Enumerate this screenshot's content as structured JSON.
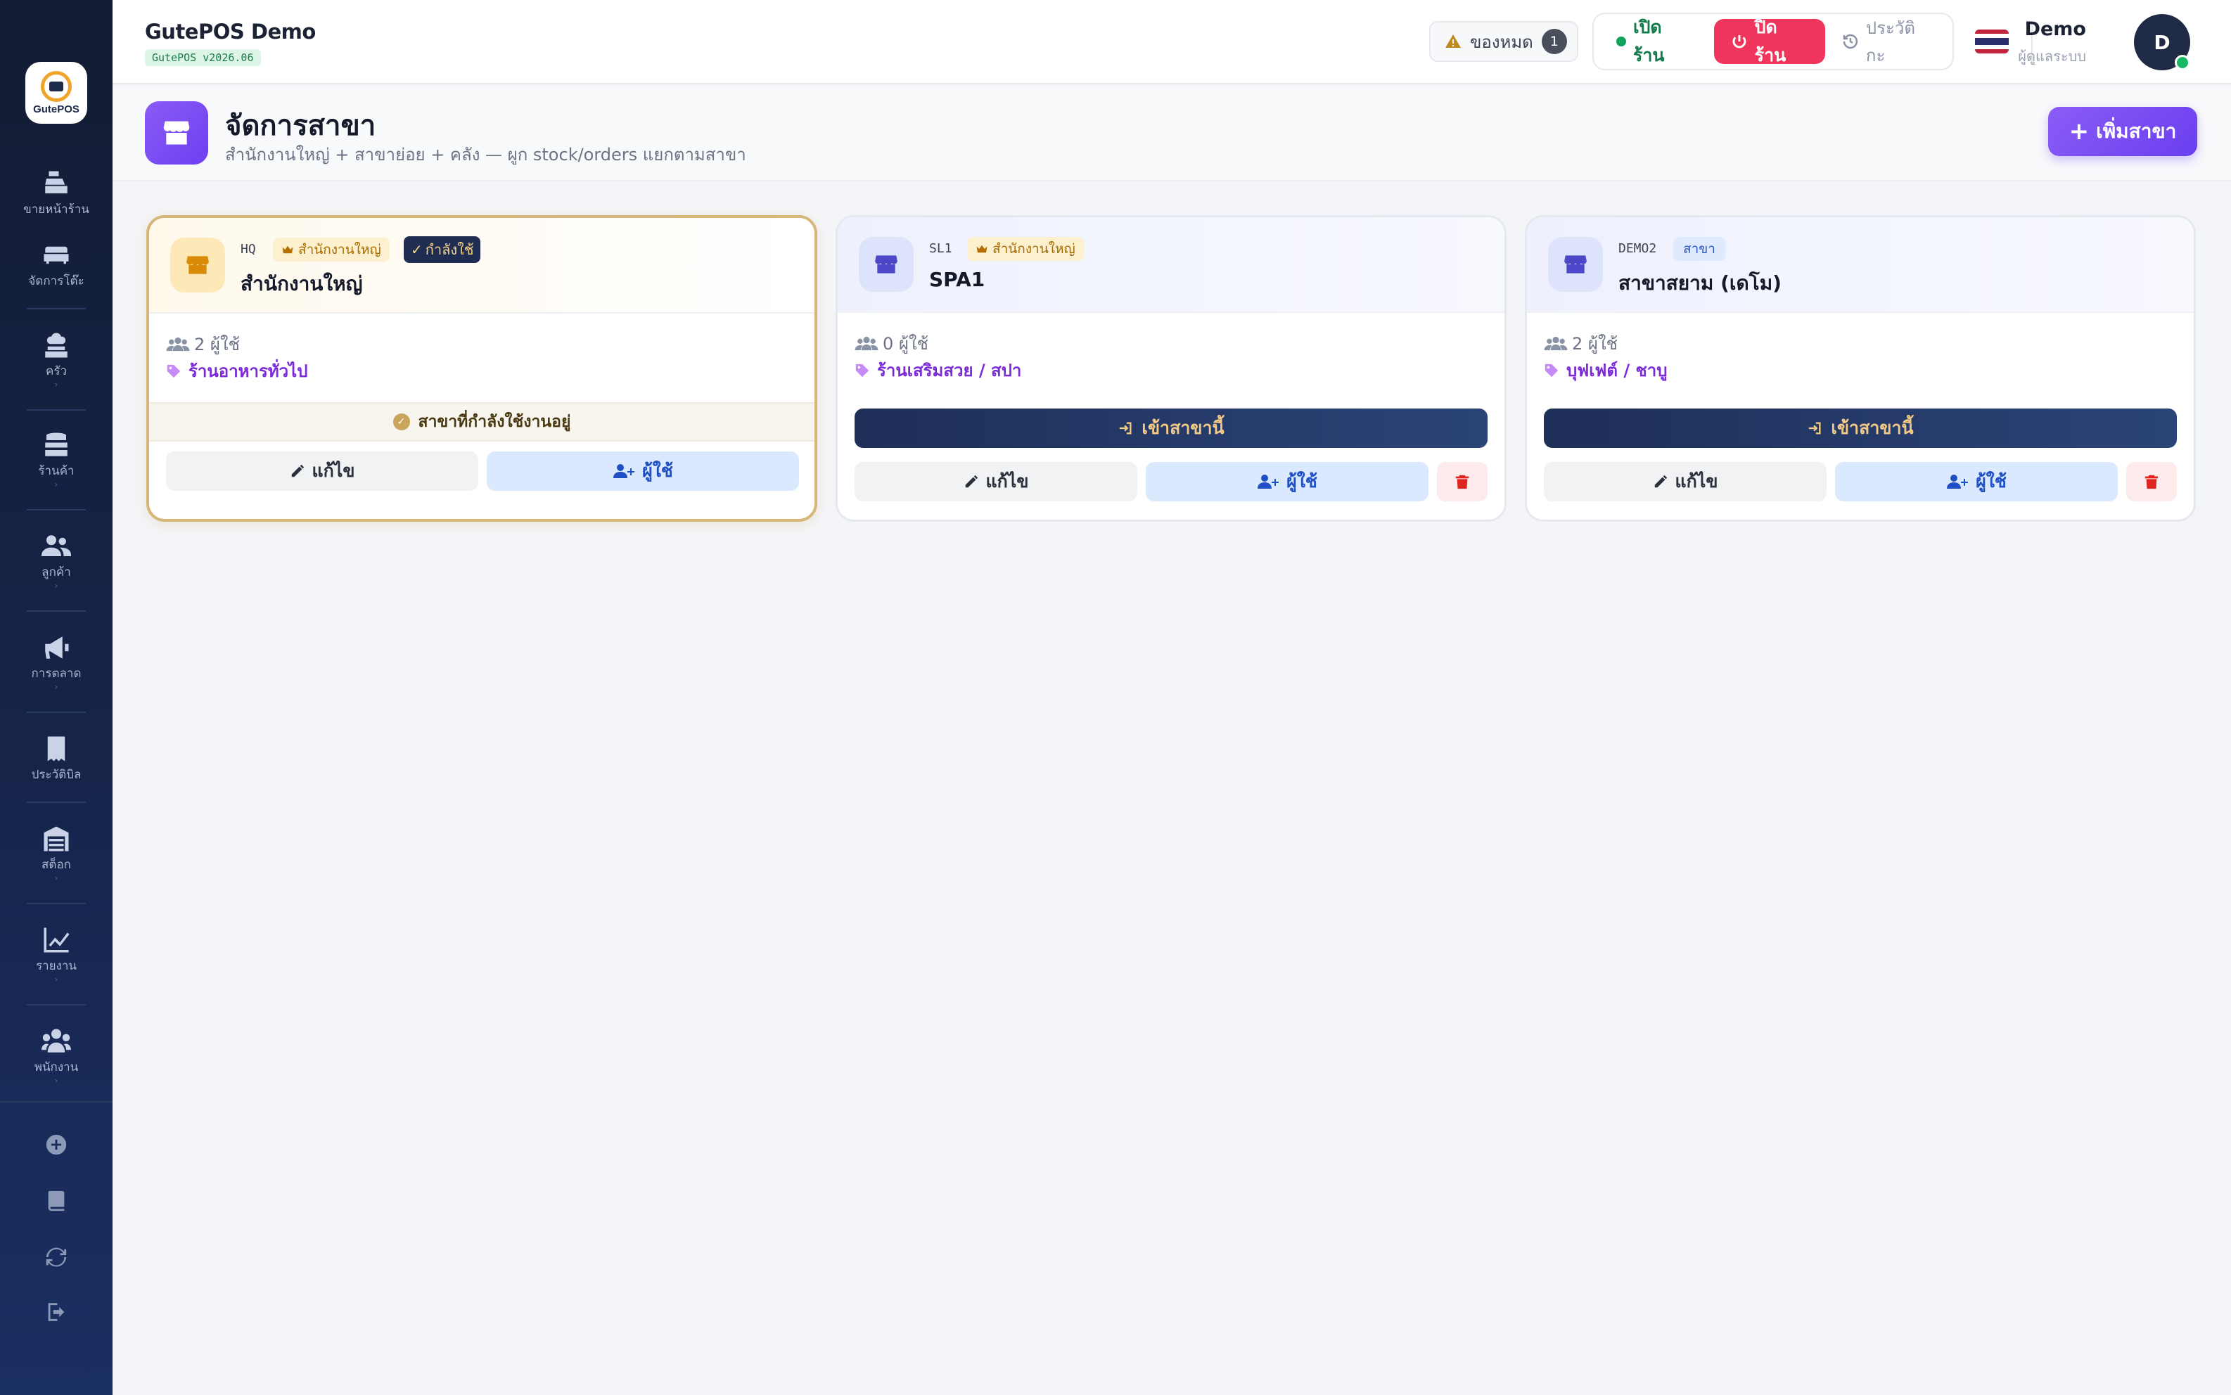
{
  "sidebar": {
    "logo_text": "GutePOS",
    "items": [
      {
        "label": "ขายหน้าร้าน",
        "icon": "cash-register-icon",
        "chevron": ""
      },
      {
        "label": "จัดการโต๊ะ",
        "icon": "couch-icon",
        "chevron": ""
      },
      {
        "label": "ครัว",
        "icon": "chef-icon",
        "chevron": "›"
      },
      {
        "label": "ร้านค้า",
        "icon": "store-stack-icon",
        "chevron": "›"
      },
      {
        "label": "ลูกค้า",
        "icon": "customers-icon",
        "chevron": "›"
      },
      {
        "label": "การตลาด",
        "icon": "megaphone-icon",
        "chevron": "›"
      },
      {
        "label": "ประวัติบิล",
        "icon": "receipt-icon",
        "chevron": ""
      },
      {
        "label": "สต็อก",
        "icon": "warehouse-icon",
        "chevron": "›"
      },
      {
        "label": "รายงาน",
        "icon": "chart-line-icon",
        "chevron": "›"
      },
      {
        "label": "พนักงาน",
        "icon": "staff-icon",
        "chevron": "›"
      }
    ]
  },
  "header": {
    "app_title": "GutePOS Demo",
    "version": "GutePOS v2026.06",
    "stock_alert": {
      "label": "ของหมด",
      "count": "1"
    },
    "open_shop": "เปิดร้าน",
    "close_shop": "ปิดร้าน",
    "history": "ประวัติกะ",
    "user": {
      "name": "Demo",
      "role": "ผู้ดูแลระบบ",
      "initial": "D"
    }
  },
  "page": {
    "title": "จัดการสาขา",
    "subtitle": "สำนักงานใหญ่ + สาขาย่อย + คลัง — ผูก stock/orders แยกตามสาขา",
    "add_button": "เพิ่มสาขา"
  },
  "branches": [
    {
      "code": "HQ",
      "hq_badge": "สำนักงานใหญ่",
      "active_badge": "กำลังใช้",
      "name": "สำนักงานใหญ่",
      "users": "2 ผู้ใช้",
      "type": "ร้านอาหารทั่วไป",
      "current_label": "สาขาที่กำลังใช้งานอยู่",
      "edit": "แก้ไข",
      "users_btn": "ผู้ใช้"
    },
    {
      "code": "SL1",
      "hq_badge": "สำนักงานใหญ่",
      "name": "SPA1",
      "users": "0 ผู้ใช้",
      "type": "ร้านเสริมสวย / สปา",
      "enter": "เข้าสาขานี้",
      "edit": "แก้ไข",
      "users_btn": "ผู้ใช้"
    },
    {
      "code": "DEMO2",
      "branch_badge": "สาขา",
      "name": "สาขาสยาม (เดโม)",
      "users": "2 ผู้ใช้",
      "type": "บุฟเฟต์ / ชาบู",
      "enter": "เข้าสาขานี้",
      "edit": "แก้ไข",
      "users_btn": "ผู้ใช้"
    }
  ],
  "colors": {
    "sidebar": "#16244a",
    "accent_purple": "#7c4dff",
    "close_red": "#f0355c",
    "open_green": "#12a15b",
    "gold": "#d6b679",
    "navy_button": "#1e2f58"
  }
}
